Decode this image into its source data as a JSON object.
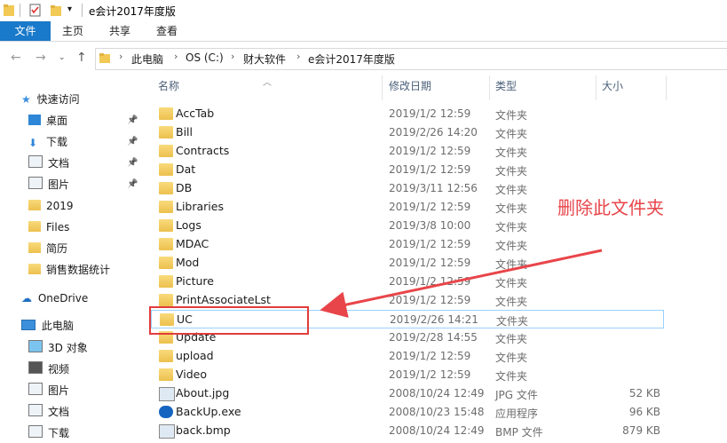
{
  "window": {
    "title": "e会计2017年度版"
  },
  "ribbon": {
    "tabs": [
      "文件",
      "主页",
      "共享",
      "查看"
    ]
  },
  "address": {
    "crumbs": [
      "此电脑",
      "OS (C:)",
      "财大软件",
      "e会计2017年度版"
    ]
  },
  "nav": {
    "quick_access": "快速访问",
    "items": [
      {
        "label": "桌面",
        "icon": "desktop-icon",
        "pinned": true
      },
      {
        "label": "下载",
        "icon": "download-icon",
        "pinned": true
      },
      {
        "label": "文档",
        "icon": "document-icon",
        "pinned": true
      },
      {
        "label": "图片",
        "icon": "picture-icon",
        "pinned": true
      },
      {
        "label": "2019",
        "icon": "folder-icon",
        "pinned": false
      },
      {
        "label": "Files",
        "icon": "folder-icon",
        "pinned": false
      },
      {
        "label": "简历",
        "icon": "folder-icon",
        "pinned": false
      },
      {
        "label": "销售数据统计",
        "icon": "folder-icon",
        "pinned": false
      }
    ],
    "onedrive": "OneDrive",
    "this_pc": "此电脑",
    "pc_items": [
      {
        "label": "3D 对象",
        "icon": "3d-objects-icon"
      },
      {
        "label": "视频",
        "icon": "video-icon"
      },
      {
        "label": "图片",
        "icon": "picture-icon"
      },
      {
        "label": "文档",
        "icon": "document-icon"
      },
      {
        "label": "下载",
        "icon": "download-icon"
      }
    ]
  },
  "columns": {
    "name": "名称",
    "date": "修改日期",
    "type": "类型",
    "size": "大小"
  },
  "files": [
    {
      "name": "AccTab",
      "date": "2019/1/2 12:59",
      "type": "文件夹",
      "size": "",
      "kind": "folder"
    },
    {
      "name": "Bill",
      "date": "2019/2/26 14:20",
      "type": "文件夹",
      "size": "",
      "kind": "folder"
    },
    {
      "name": "Contracts",
      "date": "2019/1/2 12:59",
      "type": "文件夹",
      "size": "",
      "kind": "folder"
    },
    {
      "name": "Dat",
      "date": "2019/1/2 12:59",
      "type": "文件夹",
      "size": "",
      "kind": "folder"
    },
    {
      "name": "DB",
      "date": "2019/3/11 12:56",
      "type": "文件夹",
      "size": "",
      "kind": "folder"
    },
    {
      "name": "Libraries",
      "date": "2019/1/2 12:59",
      "type": "文件夹",
      "size": "",
      "kind": "folder"
    },
    {
      "name": "Logs",
      "date": "2019/3/8 10:00",
      "type": "文件夹",
      "size": "",
      "kind": "folder"
    },
    {
      "name": "MDAC",
      "date": "2019/1/2 12:59",
      "type": "文件夹",
      "size": "",
      "kind": "folder"
    },
    {
      "name": "Mod",
      "date": "2019/1/2 12:59",
      "type": "文件夹",
      "size": "",
      "kind": "folder"
    },
    {
      "name": "Picture",
      "date": "2019/1/2 12:59",
      "type": "文件夹",
      "size": "",
      "kind": "folder"
    },
    {
      "name": "PrintAssociateLst",
      "date": "2019/1/2 12:59",
      "type": "文件夹",
      "size": "",
      "kind": "folder"
    },
    {
      "name": "UC",
      "date": "2019/2/26 14:21",
      "type": "文件夹",
      "size": "",
      "kind": "folder"
    },
    {
      "name": "Update",
      "date": "2019/2/28 14:55",
      "type": "文件夹",
      "size": "",
      "kind": "folder"
    },
    {
      "name": "upload",
      "date": "2019/1/2 12:59",
      "type": "文件夹",
      "size": "",
      "kind": "folder"
    },
    {
      "name": "Video",
      "date": "2019/1/2 12:59",
      "type": "文件夹",
      "size": "",
      "kind": "folder"
    },
    {
      "name": "About.jpg",
      "date": "2008/10/24 12:49",
      "type": "JPG 文件",
      "size": "52 KB",
      "kind": "jpg"
    },
    {
      "name": "BackUp.exe",
      "date": "2008/10/23 15:48",
      "type": "应用程序",
      "size": "96 KB",
      "kind": "exe"
    },
    {
      "name": "back.bmp",
      "date": "2008/10/24 12:49",
      "type": "BMP 文件",
      "size": "879 KB",
      "kind": "bmp"
    }
  ],
  "selected_index": 11,
  "annotation": {
    "text": "删除此文件夹",
    "color": "#e8454a"
  }
}
